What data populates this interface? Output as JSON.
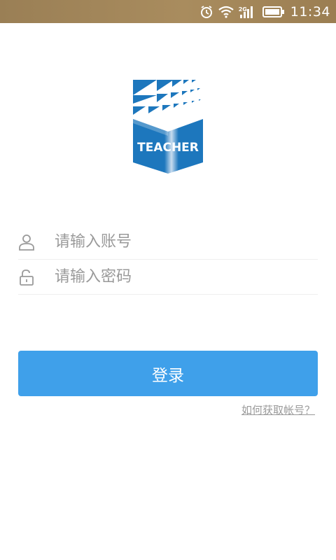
{
  "status_bar": {
    "time": "11:34",
    "network": "2G",
    "icons": [
      "alarm-icon",
      "wifi-icon",
      "signal-icon",
      "battery-icon"
    ]
  },
  "logo": {
    "text": "TEACHER",
    "primary_color": "#1d77bd"
  },
  "form": {
    "account_placeholder": "请输入账号",
    "password_placeholder": "请输入密码",
    "login_label": "登录",
    "help_link": "如何获取帐号？"
  },
  "colors": {
    "status_bar": "#a0845a",
    "accent": "#3fa0ea",
    "placeholder": "#9a9a9a"
  }
}
